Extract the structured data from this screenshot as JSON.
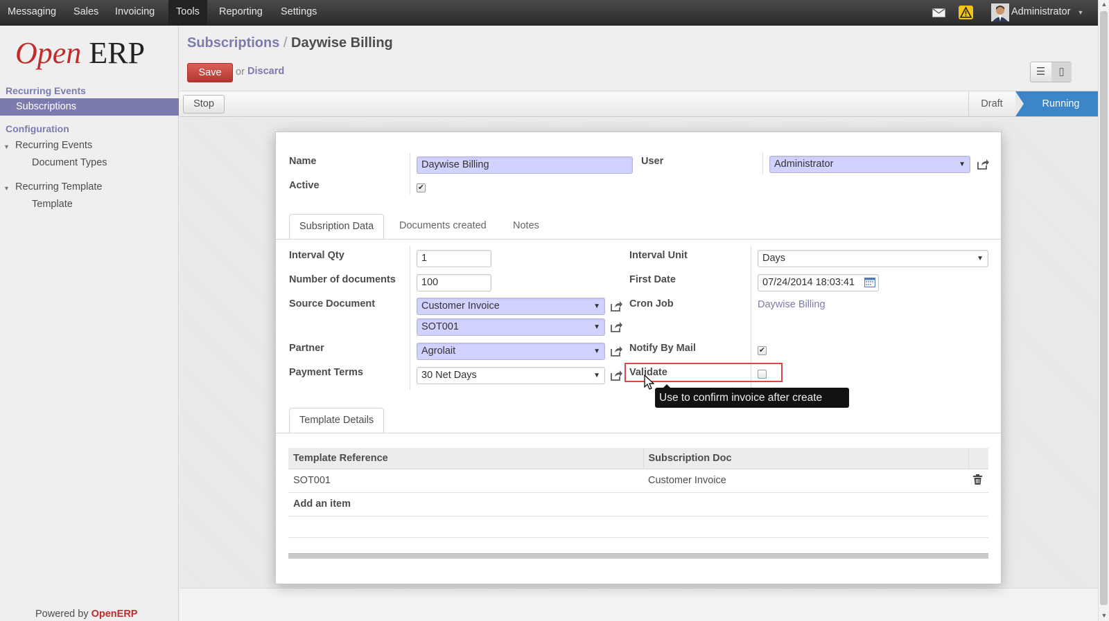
{
  "topbar": {
    "menu": [
      "Messaging",
      "Sales",
      "Invoicing",
      "Tools",
      "Reporting",
      "Settings"
    ],
    "active_menu": "Tools",
    "user": "Administrator",
    "mail_icon": "envelope-icon",
    "alert_icon": "warning-icon"
  },
  "sidebar": {
    "logo_open": "Open",
    "logo_erp": "ERP",
    "section_recurring": "Recurring Events",
    "item_subscriptions": "Subscriptions",
    "section_config": "Configuration",
    "item_recurring_events": "Recurring Events",
    "item_document_types": "Document Types",
    "item_recurring_template": "Recurring Template",
    "item_template": "Template",
    "powered_prefix": "Powered by",
    "powered_brand": "OpenERP"
  },
  "header": {
    "crumb_parent": "Subscriptions",
    "crumb_sep": "/",
    "crumb_current": "Daywise Billing",
    "save": "Save",
    "or": "or",
    "discard": "Discard"
  },
  "statusbar": {
    "stop": "Stop",
    "draft": "Draft",
    "running": "Running",
    "active_state": "Running"
  },
  "form": {
    "name_label": "Name",
    "name_value": "Daywise Billing",
    "active_label": "Active",
    "active_checked": true,
    "user_label": "User",
    "user_value": "Administrator",
    "tabs": [
      "Subsription Data",
      "Documents created",
      "Notes"
    ],
    "interval_qty_label": "Interval Qty",
    "interval_qty_value": "1",
    "num_docs_label": "Number of documents",
    "num_docs_value": "100",
    "source_doc_label": "Source Document",
    "source_doc_model": "Customer Invoice",
    "source_doc_ref": "SOT001",
    "partner_label": "Partner",
    "partner_value": "Agrolait",
    "payment_terms_label": "Payment Terms",
    "payment_terms_value": "30 Net Days",
    "interval_unit_label": "Interval Unit",
    "interval_unit_value": "Days",
    "first_date_label": "First Date",
    "first_date_value": "07/24/2014 18:03:41",
    "cron_job_label": "Cron Job",
    "cron_job_value": "Daywise Billing",
    "notify_label": "Notify By Mail",
    "notify_checked": true,
    "validate_label": "Validate",
    "validate_checked": false,
    "tooltip": "Use to confirm invoice after create"
  },
  "template_details": {
    "tab": "Template Details",
    "columns": [
      "Template Reference",
      "Subscription Doc"
    ],
    "rows": [
      [
        "SOT001",
        "Customer Invoice"
      ]
    ],
    "add_item": "Add an item"
  }
}
